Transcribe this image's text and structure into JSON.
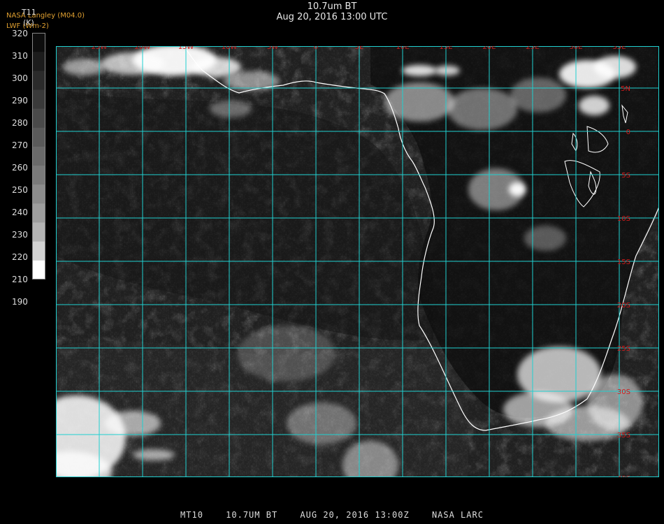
{
  "header": {
    "title": "10.7um BT",
    "subtitle": "Aug 20, 2016 13:00 UTC",
    "org_line1": "NASA Langley (M04.0)",
    "org_line2": "LWF (Wm-2)"
  },
  "colorbar": {
    "variable": "T11",
    "unit": "(K)",
    "labels": [
      "320",
      "310",
      "300",
      "290",
      "280",
      "270",
      "260",
      "250",
      "240",
      "230",
      "220",
      "210",
      "190"
    ],
    "colors": [
      "#0d0d0d",
      "#1c1c1c",
      "#2b2b2b",
      "#3a3a3a",
      "#4a4a4a",
      "#5a5a5a",
      "#6a6a6a",
      "#7a7a7a",
      "#8c8c8c",
      "#9e9e9e",
      "#b4b4b4",
      "#d2d2d2",
      "#ffffff"
    ]
  },
  "map": {
    "longitude_labels": [
      "25W",
      "20W",
      "15W",
      "10W",
      "5W",
      "0",
      "5E",
      "10E",
      "15E",
      "20E",
      "25E",
      "30E",
      "35E"
    ],
    "latitude_labels": [
      "5N",
      "0",
      "5S",
      "10S",
      "15S",
      "20S",
      "25S",
      "30S",
      "35S",
      "40S"
    ],
    "grid_color": "#20d0d0",
    "label_color": "#d21a1a",
    "coast_color": "#ffffff"
  },
  "footer": {
    "satellite": "MT10",
    "product": "10.7UM BT",
    "date": "AUG 20, 2016 13:00Z",
    "source": "NASA LARC"
  }
}
